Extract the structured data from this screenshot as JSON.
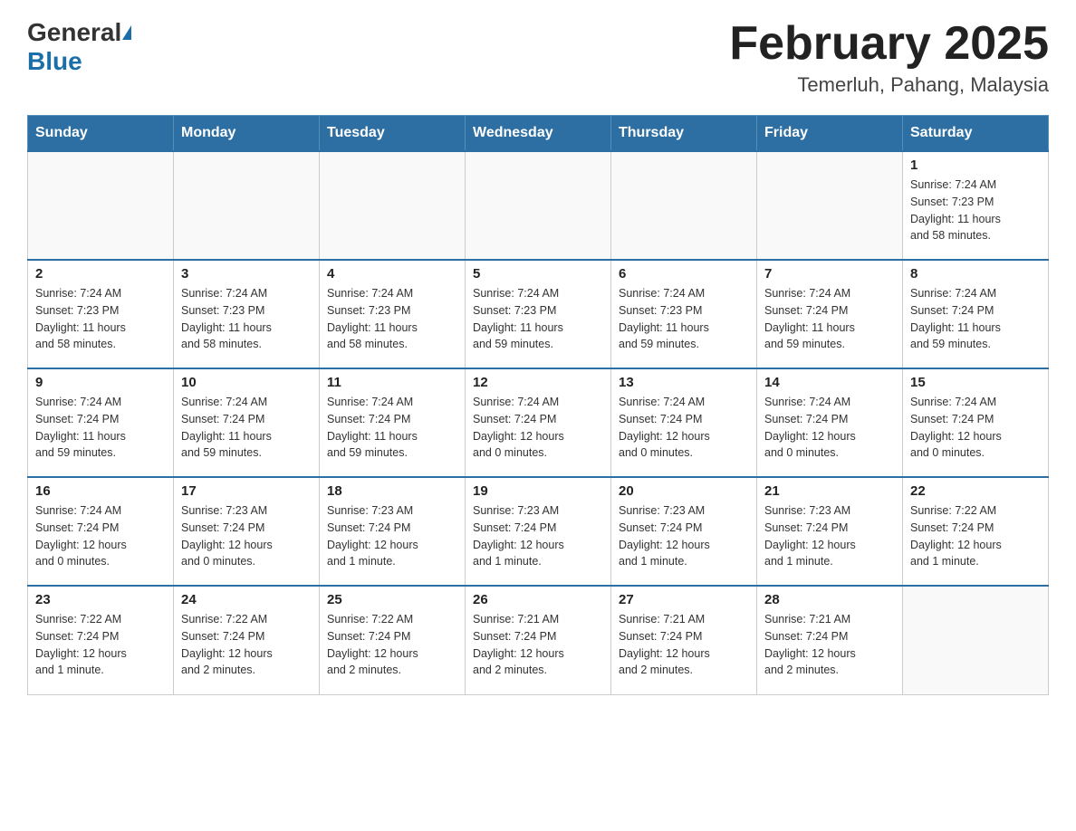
{
  "header": {
    "logo_general": "General",
    "logo_blue": "Blue",
    "title": "February 2025",
    "subtitle": "Temerluh, Pahang, Malaysia"
  },
  "weekdays": [
    "Sunday",
    "Monday",
    "Tuesday",
    "Wednesday",
    "Thursday",
    "Friday",
    "Saturday"
  ],
  "weeks": [
    [
      {
        "day": "",
        "info": ""
      },
      {
        "day": "",
        "info": ""
      },
      {
        "day": "",
        "info": ""
      },
      {
        "day": "",
        "info": ""
      },
      {
        "day": "",
        "info": ""
      },
      {
        "day": "",
        "info": ""
      },
      {
        "day": "1",
        "info": "Sunrise: 7:24 AM\nSunset: 7:23 PM\nDaylight: 11 hours\nand 58 minutes."
      }
    ],
    [
      {
        "day": "2",
        "info": "Sunrise: 7:24 AM\nSunset: 7:23 PM\nDaylight: 11 hours\nand 58 minutes."
      },
      {
        "day": "3",
        "info": "Sunrise: 7:24 AM\nSunset: 7:23 PM\nDaylight: 11 hours\nand 58 minutes."
      },
      {
        "day": "4",
        "info": "Sunrise: 7:24 AM\nSunset: 7:23 PM\nDaylight: 11 hours\nand 58 minutes."
      },
      {
        "day": "5",
        "info": "Sunrise: 7:24 AM\nSunset: 7:23 PM\nDaylight: 11 hours\nand 59 minutes."
      },
      {
        "day": "6",
        "info": "Sunrise: 7:24 AM\nSunset: 7:23 PM\nDaylight: 11 hours\nand 59 minutes."
      },
      {
        "day": "7",
        "info": "Sunrise: 7:24 AM\nSunset: 7:24 PM\nDaylight: 11 hours\nand 59 minutes."
      },
      {
        "day": "8",
        "info": "Sunrise: 7:24 AM\nSunset: 7:24 PM\nDaylight: 11 hours\nand 59 minutes."
      }
    ],
    [
      {
        "day": "9",
        "info": "Sunrise: 7:24 AM\nSunset: 7:24 PM\nDaylight: 11 hours\nand 59 minutes."
      },
      {
        "day": "10",
        "info": "Sunrise: 7:24 AM\nSunset: 7:24 PM\nDaylight: 11 hours\nand 59 minutes."
      },
      {
        "day": "11",
        "info": "Sunrise: 7:24 AM\nSunset: 7:24 PM\nDaylight: 11 hours\nand 59 minutes."
      },
      {
        "day": "12",
        "info": "Sunrise: 7:24 AM\nSunset: 7:24 PM\nDaylight: 12 hours\nand 0 minutes."
      },
      {
        "day": "13",
        "info": "Sunrise: 7:24 AM\nSunset: 7:24 PM\nDaylight: 12 hours\nand 0 minutes."
      },
      {
        "day": "14",
        "info": "Sunrise: 7:24 AM\nSunset: 7:24 PM\nDaylight: 12 hours\nand 0 minutes."
      },
      {
        "day": "15",
        "info": "Sunrise: 7:24 AM\nSunset: 7:24 PM\nDaylight: 12 hours\nand 0 minutes."
      }
    ],
    [
      {
        "day": "16",
        "info": "Sunrise: 7:24 AM\nSunset: 7:24 PM\nDaylight: 12 hours\nand 0 minutes."
      },
      {
        "day": "17",
        "info": "Sunrise: 7:23 AM\nSunset: 7:24 PM\nDaylight: 12 hours\nand 0 minutes."
      },
      {
        "day": "18",
        "info": "Sunrise: 7:23 AM\nSunset: 7:24 PM\nDaylight: 12 hours\nand 1 minute."
      },
      {
        "day": "19",
        "info": "Sunrise: 7:23 AM\nSunset: 7:24 PM\nDaylight: 12 hours\nand 1 minute."
      },
      {
        "day": "20",
        "info": "Sunrise: 7:23 AM\nSunset: 7:24 PM\nDaylight: 12 hours\nand 1 minute."
      },
      {
        "day": "21",
        "info": "Sunrise: 7:23 AM\nSunset: 7:24 PM\nDaylight: 12 hours\nand 1 minute."
      },
      {
        "day": "22",
        "info": "Sunrise: 7:22 AM\nSunset: 7:24 PM\nDaylight: 12 hours\nand 1 minute."
      }
    ],
    [
      {
        "day": "23",
        "info": "Sunrise: 7:22 AM\nSunset: 7:24 PM\nDaylight: 12 hours\nand 1 minute."
      },
      {
        "day": "24",
        "info": "Sunrise: 7:22 AM\nSunset: 7:24 PM\nDaylight: 12 hours\nand 2 minutes."
      },
      {
        "day": "25",
        "info": "Sunrise: 7:22 AM\nSunset: 7:24 PM\nDaylight: 12 hours\nand 2 minutes."
      },
      {
        "day": "26",
        "info": "Sunrise: 7:21 AM\nSunset: 7:24 PM\nDaylight: 12 hours\nand 2 minutes."
      },
      {
        "day": "27",
        "info": "Sunrise: 7:21 AM\nSunset: 7:24 PM\nDaylight: 12 hours\nand 2 minutes."
      },
      {
        "day": "28",
        "info": "Sunrise: 7:21 AM\nSunset: 7:24 PM\nDaylight: 12 hours\nand 2 minutes."
      },
      {
        "day": "",
        "info": ""
      }
    ]
  ]
}
